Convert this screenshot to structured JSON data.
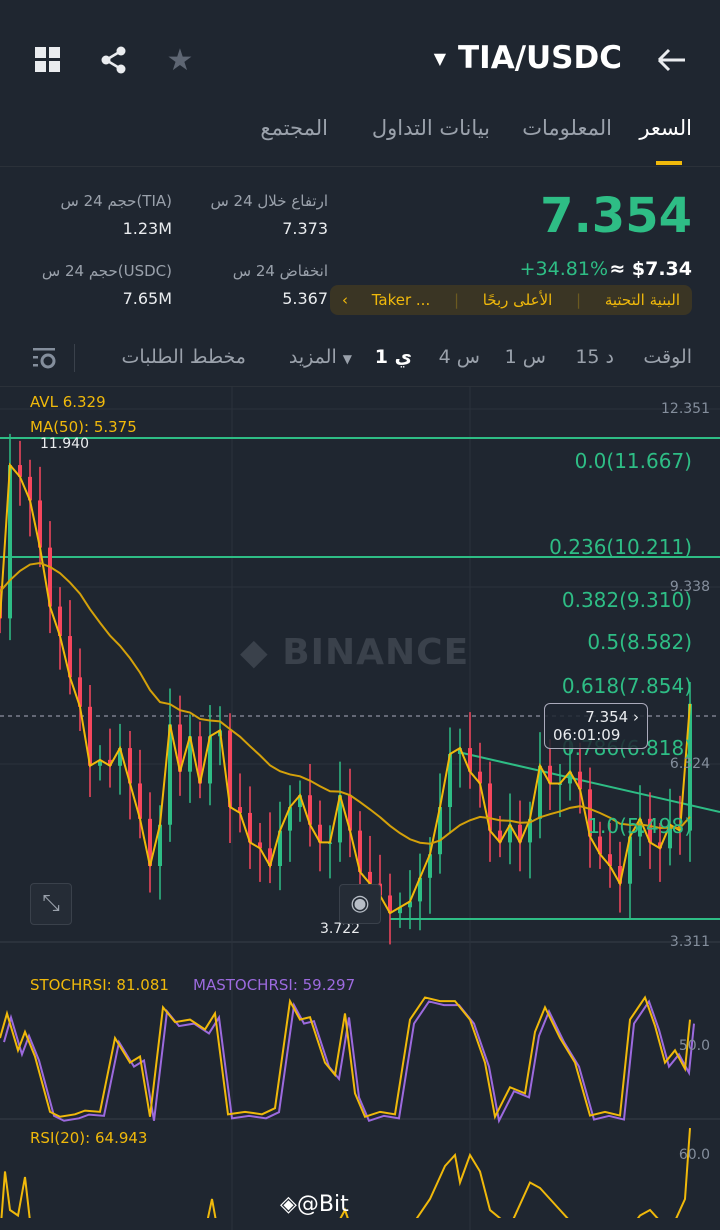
{
  "header": {
    "pair": "TIA/USDC",
    "back_icon": "arrow-right",
    "grid_icon": "grid",
    "share_icon": "share",
    "star_icon": "star"
  },
  "tabs": [
    {
      "label": "السعر",
      "active": true
    },
    {
      "label": "المعلومات"
    },
    {
      "label": "بيانات التداول"
    },
    {
      "label": "المجتمع"
    }
  ],
  "price": {
    "last": "7.354",
    "change": "+34.81%",
    "usd": "≈ $7.34"
  },
  "stats": {
    "high_label": "ارتفاع خلال 24 س",
    "high": "7.373",
    "low_label": "انخفاض 24 س",
    "low": "5.367",
    "vol_tia_label": "حجم 24 س(TIA)",
    "vol_tia": "1.23M",
    "vol_usdc_label": "حجم 24 س(USDC)",
    "vol_usdc": "7.65M"
  },
  "tags": {
    "t1": "البنية التحتية",
    "t2": "الأعلى ربحًا",
    "t3": "Taker ...",
    "color": "#f0b90b"
  },
  "timeframes": {
    "label": "الوقت",
    "t15m": "15 د",
    "t1h": "1 س",
    "t4h": "4 س",
    "t1d": "1 ي",
    "more": "المزيد",
    "depth": "مخطط الطلبات"
  },
  "chart": {
    "avl": "AVL 6.329",
    "ma": "MA(50): 5.375",
    "watermark": "BINANCE",
    "high_mark": "11.940",
    "low_mark": "3.722",
    "axis": [
      "12.351",
      "9.338",
      "6.324",
      "3.311"
    ],
    "fib": [
      "0.0(11.667)",
      "0.236(10.211)",
      "0.382(9.310)",
      "0.5(8.582)",
      "0.618(7.854)",
      "0.786(6.818)",
      "1.0(5.498)"
    ],
    "tooltip_price": "7.354",
    "tooltip_time": "06:01:09"
  },
  "stoch": {
    "label": "STOCHRSI: 81.081",
    "ma_label": "MASTOCHRSI: 59.297",
    "axis": "50.0"
  },
  "rsi": {
    "label": "RSI(20): 64.943",
    "axis": "60.0"
  },
  "footer": {
    "watermark": "@Bit"
  },
  "chart_data": {
    "type": "line",
    "price_range": [
      3.311,
      12.351
    ],
    "closes": [
      8.8,
      11.4,
      11.2,
      10.8,
      10.0,
      9.0,
      8.5,
      7.8,
      7.3,
      6.3,
      6.4,
      6.3,
      6.6,
      6.0,
      5.4,
      4.6,
      5.3,
      7.0,
      6.2,
      6.8,
      6.0,
      6.8,
      6.9,
      5.6,
      5.5,
      5.0,
      4.9,
      4.6,
      5.2,
      5.6,
      5.8,
      5.3,
      5.0,
      5.0,
      5.8,
      5.2,
      4.5,
      4.3,
      4.1,
      3.8,
      3.9,
      4.0,
      4.4,
      4.8,
      5.6,
      6.5,
      6.6,
      6.2,
      6.0,
      5.2,
      5.0,
      5.3,
      5.0,
      5.4,
      6.3,
      6.0,
      6.0,
      6.2,
      5.9,
      5.1,
      4.8,
      4.6,
      4.3,
      5.1,
      5.4,
      5.0,
      4.9,
      5.3,
      5.2,
      7.35
    ],
    "stoch_x": [
      0,
      7,
      18,
      25,
      35,
      50,
      60,
      75,
      85,
      100,
      115,
      130,
      140,
      150,
      163,
      175,
      190,
      205,
      215,
      228,
      245,
      262,
      275,
      290,
      300,
      310,
      325,
      335,
      345,
      355,
      365,
      380,
      395,
      410,
      425,
      440,
      455,
      470,
      485,
      495,
      510,
      525,
      535,
      545,
      560,
      575,
      590,
      605,
      620,
      630,
      645,
      655,
      665,
      675,
      685,
      690
    ],
    "stoch": [
      65,
      85,
      55,
      70,
      50,
      5,
      1,
      3,
      6,
      5,
      65,
      45,
      50,
      1,
      90,
      78,
      80,
      72,
      85,
      3,
      5,
      3,
      8,
      95,
      80,
      82,
      45,
      35,
      85,
      20,
      1,
      5,
      3,
      80,
      98,
      95,
      95,
      80,
      45,
      1,
      25,
      20,
      70,
      90,
      65,
      45,
      2,
      5,
      2,
      80,
      98,
      75,
      45,
      55,
      40,
      80
    ],
    "rsi_x": [
      0,
      5,
      10,
      18,
      25,
      30,
      40,
      47,
      165,
      175,
      185,
      195,
      205,
      212,
      220,
      235,
      300,
      330,
      345,
      360,
      375,
      400,
      430,
      445,
      455,
      460,
      470,
      480,
      490,
      510,
      530,
      540,
      550,
      560,
      580,
      600,
      620,
      640,
      650,
      660,
      675,
      685,
      690
    ],
    "rsi": [
      45,
      57,
      50,
      49,
      56,
      48,
      45,
      40,
      43,
      48,
      42,
      47,
      46,
      52,
      44,
      40,
      40,
      45,
      50,
      42,
      40,
      44,
      52,
      58,
      60,
      55,
      60,
      57,
      50,
      47,
      55,
      54,
      52,
      50,
      46,
      45,
      44,
      49,
      50,
      48,
      48,
      52,
      64.9
    ]
  }
}
